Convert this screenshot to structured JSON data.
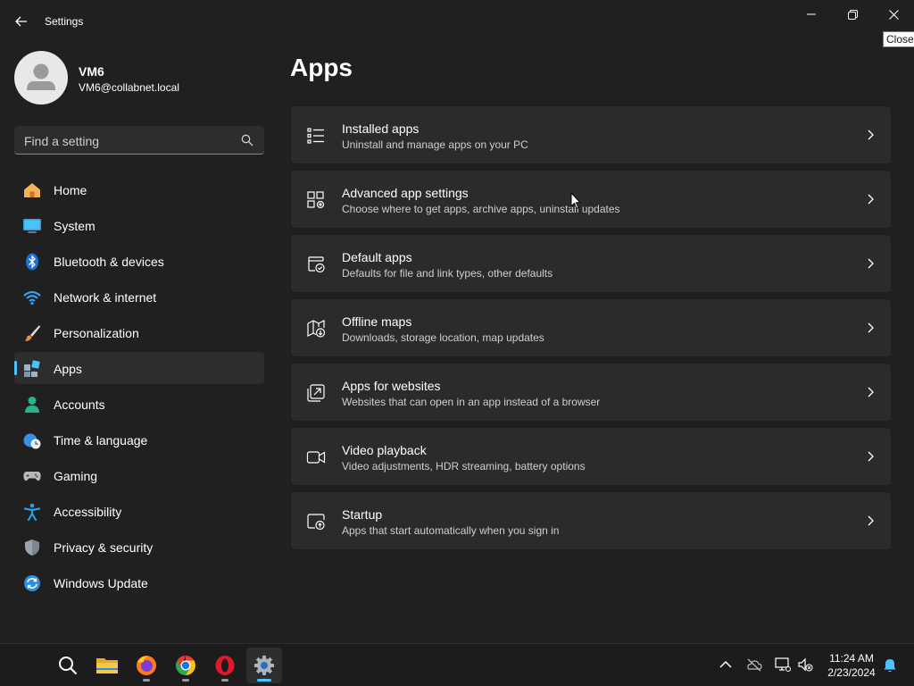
{
  "window": {
    "title": "Settings",
    "tooltip": "Close"
  },
  "profile": {
    "name": "VM6",
    "email": "VM6@collabnet.local"
  },
  "search": {
    "placeholder": "Find a setting"
  },
  "sidebar": {
    "items": [
      {
        "label": "Home",
        "icon": "home-icon"
      },
      {
        "label": "System",
        "icon": "system-icon"
      },
      {
        "label": "Bluetooth & devices",
        "icon": "bluetooth-icon"
      },
      {
        "label": "Network & internet",
        "icon": "wifi-icon"
      },
      {
        "label": "Personalization",
        "icon": "brush-icon"
      },
      {
        "label": "Apps",
        "icon": "apps-icon",
        "selected": true
      },
      {
        "label": "Accounts",
        "icon": "person-icon"
      },
      {
        "label": "Time & language",
        "icon": "globe-clock-icon"
      },
      {
        "label": "Gaming",
        "icon": "gamepad-icon"
      },
      {
        "label": "Accessibility",
        "icon": "accessibility-icon"
      },
      {
        "label": "Privacy & security",
        "icon": "shield-icon"
      },
      {
        "label": "Windows Update",
        "icon": "update-icon"
      }
    ]
  },
  "main": {
    "title": "Apps",
    "cards": [
      {
        "title": "Installed apps",
        "description": "Uninstall and manage apps on your PC",
        "icon": "list-icon"
      },
      {
        "title": "Advanced app settings",
        "description": "Choose where to get apps, archive apps, uninstall updates",
        "icon": "app-settings-icon"
      },
      {
        "title": "Default apps",
        "description": "Defaults for file and link types, other defaults",
        "icon": "default-apps-icon"
      },
      {
        "title": "Offline maps",
        "description": "Downloads, storage location, map updates",
        "icon": "map-download-icon"
      },
      {
        "title": "Apps for websites",
        "description": "Websites that can open in an app instead of a browser",
        "icon": "open-in-app-icon"
      },
      {
        "title": "Video playback",
        "description": "Video adjustments, HDR streaming, battery options",
        "icon": "video-camera-icon"
      },
      {
        "title": "Startup",
        "description": "Apps that start automatically when you sign in",
        "icon": "startup-icon"
      }
    ]
  },
  "taskbar": {
    "apps": [
      "search-icon",
      "file-explorer-icon",
      "firefox-icon",
      "chrome-icon",
      "opera-icon",
      "settings-icon"
    ],
    "time": "11:24 AM",
    "date": "2/23/2024"
  },
  "colors": {
    "background": "#202020",
    "card": "#2b2b2b",
    "accent": "#4cc2ff"
  }
}
